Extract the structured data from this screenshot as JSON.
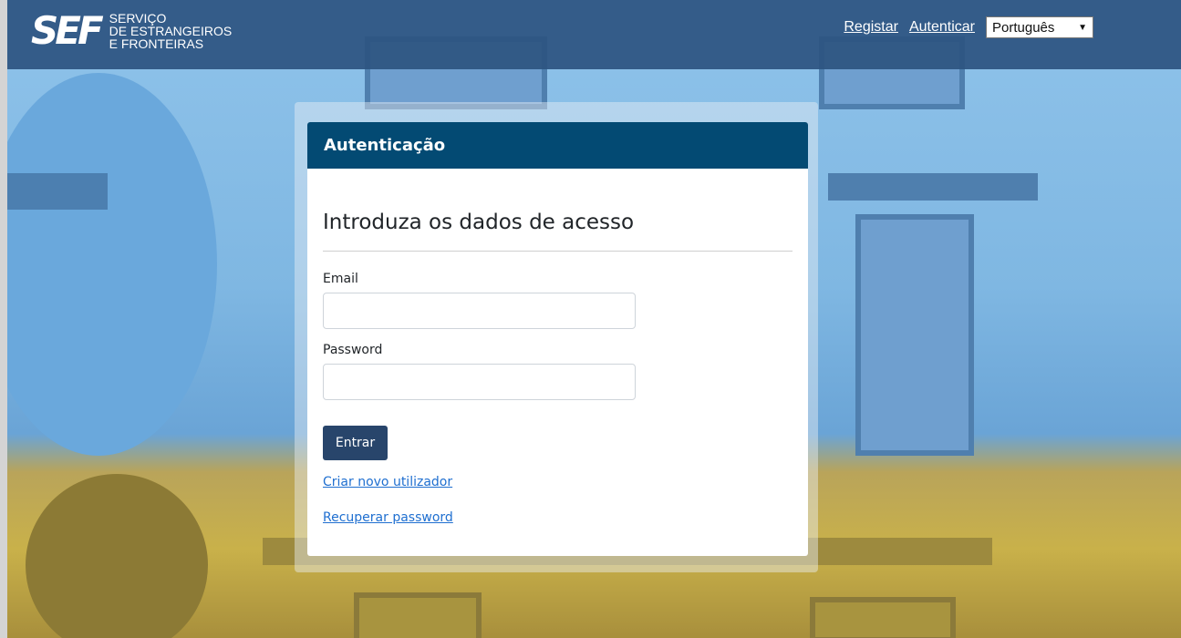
{
  "header": {
    "logo_mark": "SEF",
    "logo_line1": "SERVIÇO",
    "logo_line2": "DE ESTRANGEIROS",
    "logo_line3": "E FRONTEIRAS",
    "nav_register": "Registar",
    "nav_login": "Autenticar",
    "language_selected": "Português"
  },
  "card": {
    "header_title": "Autenticação",
    "title": "Introduza os dados de acesso",
    "email_label": "Email",
    "email_value": "",
    "password_label": "Password",
    "password_value": "",
    "submit_label": "Entrar",
    "create_user_link": "Criar novo utilizador",
    "recover_password_link": "Recuperar password"
  },
  "colors": {
    "topbar": "#2c5480",
    "card_header": "#034a73",
    "button": "#28456b",
    "link": "#1f6fd0"
  }
}
